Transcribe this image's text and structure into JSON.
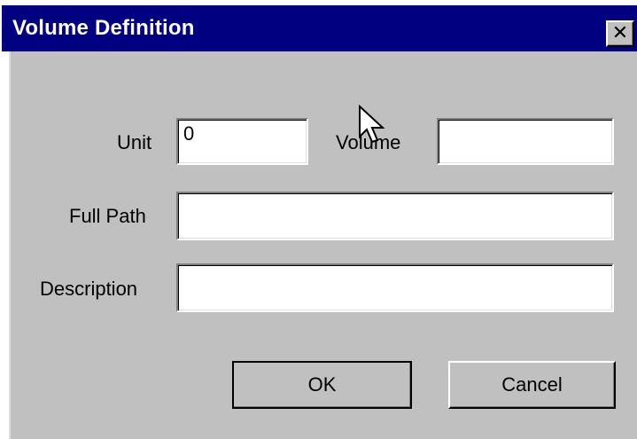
{
  "window": {
    "title": "Volume Definition",
    "close_glyph": "✕",
    "colors": {
      "titlebar": "#000080",
      "face": "#c0c0c0"
    }
  },
  "form": {
    "unit": {
      "label": "Unit",
      "value": "0"
    },
    "volume": {
      "label": "Volume",
      "value": ""
    },
    "full_path": {
      "label": "Full Path",
      "value": ""
    },
    "description": {
      "label": "Description",
      "value": ""
    }
  },
  "buttons": {
    "ok_label": "OK",
    "cancel_label": "Cancel"
  },
  "pointer": {
    "icon": "arrow-cursor-icon"
  }
}
